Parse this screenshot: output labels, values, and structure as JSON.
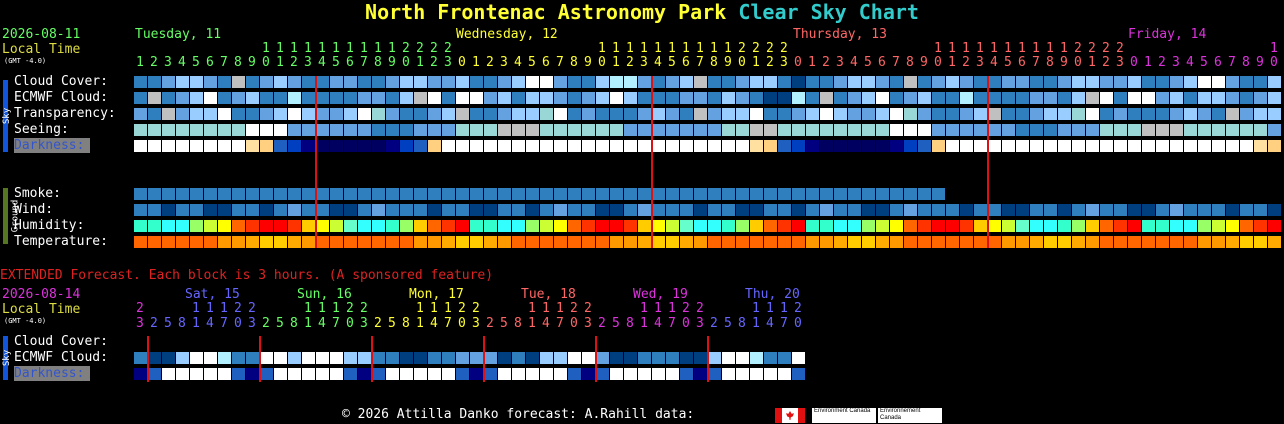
{
  "title": {
    "part1": "North Frontenac Astronomy Park",
    "part2": "Clear Sky Chart"
  },
  "header": {
    "date": "2026-08-11",
    "local_time": "Local Time",
    "gmt": "(GMT -4.0)",
    "days": [
      {
        "label": "Tuesday, 11",
        "color": "#66ff66"
      },
      {
        "label": "Wednesday, 12",
        "color": "#ffff33"
      },
      {
        "label": "Thursday, 13",
        "color": "#ff6666"
      },
      {
        "label": "Friday, 14",
        "color": "#dd33dd"
      }
    ],
    "tens_digits": "1111111111222211111111112222111111111122221111111111112",
    "ones_digits": "123456789012301234567890123012345678901230123456789012301234567890123456789012345678901230123456789"
  },
  "sky_tab": "Sky",
  "ground_tab": "Ground",
  "rows": {
    "cloud": "Cloud Cover:",
    "ecmwf": "ECMWF Cloud:",
    "transparency": "Transparency:",
    "seeing": "Seeing:",
    "darkness": "Darkness:",
    "smoke": "Smoke:",
    "wind": "Wind:",
    "humidity": "Humidity:",
    "temperature": "Temperature:"
  },
  "colors": {
    "dark_blue": "#003f7f",
    "mid_blue": "#2f7fbf",
    "light_blue": "#63a1e0",
    "pale_blue": "#99ccff",
    "cyan_pale": "#b3f0ff",
    "white": "#ffffff",
    "gray": "#c0c0c0",
    "teal": "#99d7d7",
    "red_line": "#dd1111"
  },
  "extended": {
    "notice": "EXTENDED Forecast. Each block is 3 hours. (A sponsored feature)",
    "date": "2026-08-14",
    "local_time": "Local Time",
    "gmt": "(GMT -4.0)",
    "days": [
      {
        "label": "Sat, 15",
        "color": "#6666ff"
      },
      {
        "label": "Sun, 16",
        "color": "#66ff66"
      },
      {
        "label": "Mon, 17",
        "color": "#ffff33"
      },
      {
        "label": "Tue, 18",
        "color": "#ff6666"
      },
      {
        "label": "Wed, 19",
        "color": "#dd33dd"
      },
      {
        "label": "Thu, 20",
        "color": "#6666ff"
      }
    ],
    "tens_first": "2",
    "tens_group": "11122",
    "tens_last": "1112",
    "ones_first": "3",
    "ones_group": "25814703",
    "ones_last": "2581470",
    "rows": {
      "cloud": "Cloud Cover:",
      "ecmwf": "ECMWF Cloud:",
      "darkness": "Darkness:"
    }
  },
  "footer": {
    "copyright": "© 2026 Attilla Danko",
    "forecast": "forecast: A.Rahill",
    "data": "data:",
    "agency1": "Environment Canada",
    "agency2": "Environnement Canada"
  }
}
